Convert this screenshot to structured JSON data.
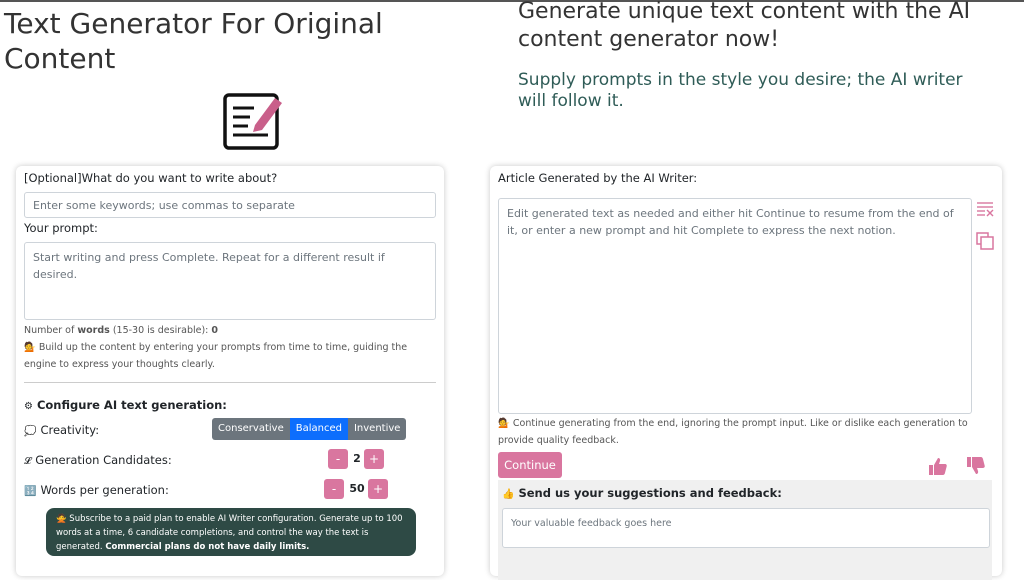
{
  "header": {
    "title": "Text Generator For Original Content",
    "heading": "Generate unique text content with the AI content generator now!",
    "subheading": "Supply prompts in the style you desire; the AI writer will follow it."
  },
  "left": {
    "topic_label": "[Optional]What do you want to write about?",
    "topic_placeholder": "Enter some keywords; use commas to separate",
    "prompt_label": "Your prompt:",
    "prompt_placeholder": "Start writing and press Complete. Repeat for a different result if desired.",
    "word_count_prefix": "Number of ",
    "word_count_bold": "words",
    "word_count_suffix": " (15-30 is desirable): ",
    "word_count_value": "0",
    "tip_emoji": "💁",
    "tip": "Build up the content by entering your prompts from time to time, guiding the engine to express your thoughts clearly.",
    "config_emoji": "⚙",
    "config_title": "Configure AI text generation:",
    "creativity_emoji": "💭",
    "creativity_label": "Creativity:",
    "creativity_options": [
      "Conservative",
      "Balanced",
      "Inventive"
    ],
    "creativity_selected": "Balanced",
    "candidates_emoji": "𝓛",
    "candidates_label": "Generation Candidates:",
    "candidates_value": "2",
    "words_emoji": "🔢",
    "words_label": "Words per generation:",
    "words_value": "50",
    "minus": "-",
    "plus": "+",
    "notice_emoji": "🙅",
    "notice_text": "Subscribe to a paid plan to enable AI Writer configuration. Generate up to 100 words at a time, 6 candidate completions, and control the way the text is generated. ",
    "notice_bold": "Commercial plans do not have daily limits."
  },
  "right": {
    "article_label": "Article Generated by the AI Writer:",
    "article_placeholder": "Edit generated text as needed and either hit Continue to resume from the end of it, or enter a new prompt and hit Complete to express the next notion.",
    "tip_emoji": "💁",
    "tip": "Continue generating from the end, ignoring the prompt input. Like or dislike each generation to provide quality feedback.",
    "continue_label": "Continue",
    "feedback_emoji": "👍",
    "feedback_title": "Send us your suggestions and feedback:",
    "feedback_placeholder": "Your valuable feedback goes here"
  },
  "colors": {
    "accent": "#d9769f",
    "selected": "#0d6efd",
    "notice_bg": "#2e4a45",
    "subheading": "#2f5c57"
  },
  "icons": [
    "document-edit-icon",
    "clear-text-icon",
    "copy-icon",
    "thumbs-up-icon",
    "thumbs-down-icon"
  ]
}
